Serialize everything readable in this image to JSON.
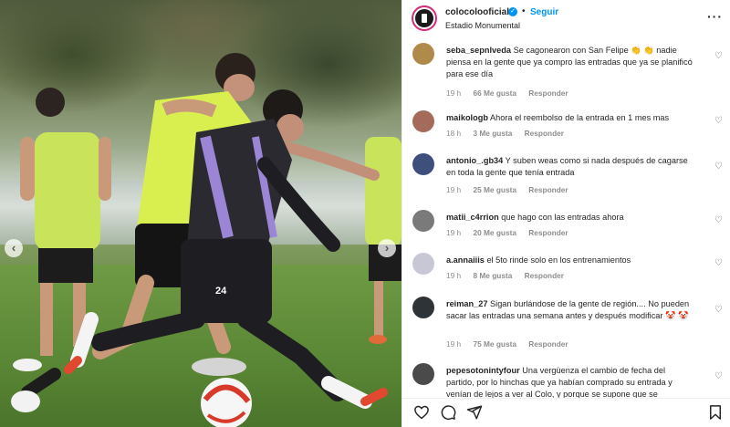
{
  "header": {
    "username": "colocolooficial",
    "follow_label": "Seguir",
    "separator": "•",
    "location": "Estadio Monumental",
    "more_label": "···",
    "verified_glyph": "✓"
  },
  "photo": {
    "prev_glyph": "‹",
    "next_glyph": "›",
    "jersey_number": "24"
  },
  "comments": [
    {
      "user": "seba_sepnlveda",
      "text": "Se cagonearon con San Felipe 👏 👏 nadie piensa en la gente que ya compro las entradas que ya se planificó para ese día",
      "time": "19 h",
      "likes": "66 Me gusta",
      "reply": "Responder",
      "avatar_color": "#b08a4a"
    },
    {
      "user": "maikologb",
      "text": "Ahora el reembolso de la entrada en 1 mes mas",
      "time": "18 h",
      "likes": "3 Me gusta",
      "reply": "Responder",
      "avatar_color": "#a46b5a"
    },
    {
      "user": "antonio_.gb34",
      "text": "Y suben weas como si nada después de cagarse en toda la gente que tenía entrada",
      "time": "19 h",
      "likes": "25 Me gusta",
      "reply": "Responder",
      "avatar_color": "#3d4f7a"
    },
    {
      "user": "matii_c4rrion",
      "text": "que hago con las entradas ahora",
      "time": "19 h",
      "likes": "20 Me gusta",
      "reply": "Responder",
      "avatar_color": "#7a7a7a"
    },
    {
      "user": "a.annaiiis",
      "text": "el 5to rinde solo en los entrenamientos",
      "time": "19 h",
      "likes": "8 Me gusta",
      "reply": "Responder",
      "avatar_color": "#c7c7d6"
    },
    {
      "user": "reiman_27",
      "text": "Sigan burlándose de la gente de región.... No pueden sacar las entradas una semana antes y después modificar 🤡 🤡",
      "time": "19 h",
      "likes": "75 Me gusta",
      "reply": "Responder",
      "avatar_color": "#2e3338"
    },
    {
      "user": "pepesotonintyfour",
      "text": "Una vergüenza el cambio de fecha del partido, por lo hinchas que ya habían comprado su entrada y venían de lejos a ver al Colo, y porque se supone que se",
      "time": "",
      "likes": "",
      "reply": "",
      "avatar_color": "#4a4a4a"
    }
  ],
  "actions": {
    "like_icon": "heart-outline",
    "comment_icon": "comment-bubble",
    "share_icon": "paper-plane",
    "save_icon": "bookmark"
  },
  "colors": {
    "accent": "#0095f6",
    "muted": "#8e8e8e",
    "text": "#262626"
  }
}
